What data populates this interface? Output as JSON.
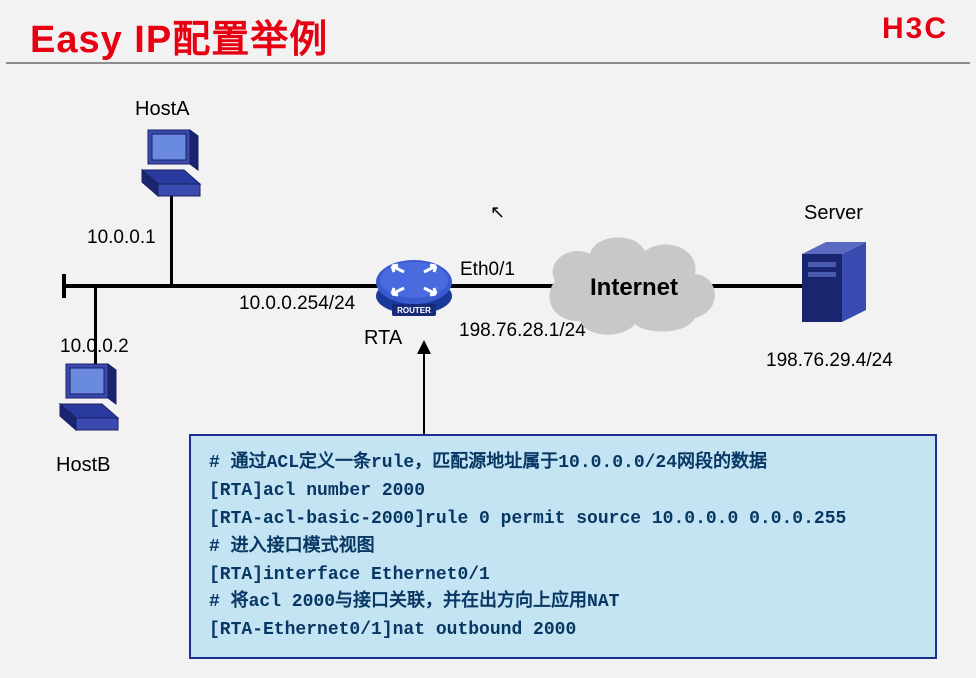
{
  "title": "Easy IP配置举例",
  "logo": "H3C",
  "labels": {
    "hostA": "HostA",
    "hostA_ip": "10.0.0.1",
    "hostB": "HostB",
    "hostB_ip": "10.0.0.2",
    "lan_gw": "10.0.0.254/24",
    "router": "RTA",
    "eth": "Eth0/1",
    "wan_ip": "198.76.28.1/24",
    "internet": "Internet",
    "server": "Server",
    "server_ip": "198.76.29.4/24"
  },
  "config": {
    "line1": "# 通过ACL定义一条rule，匹配源地址属于10.0.0.0/24网段的数据",
    "line2": "[RTA]acl number 2000",
    "line3": "[RTA-acl-basic-2000]rule 0 permit source 10.0.0.0 0.0.0.255",
    "line4": "# 进入接口模式视图",
    "line5": "[RTA]interface Ethernet0/1",
    "line6": "# 将acl 2000与接口关联，并在出方向上应用NAT",
    "line7": "[RTA-Ethernet0/1]nat outbound 2000"
  }
}
